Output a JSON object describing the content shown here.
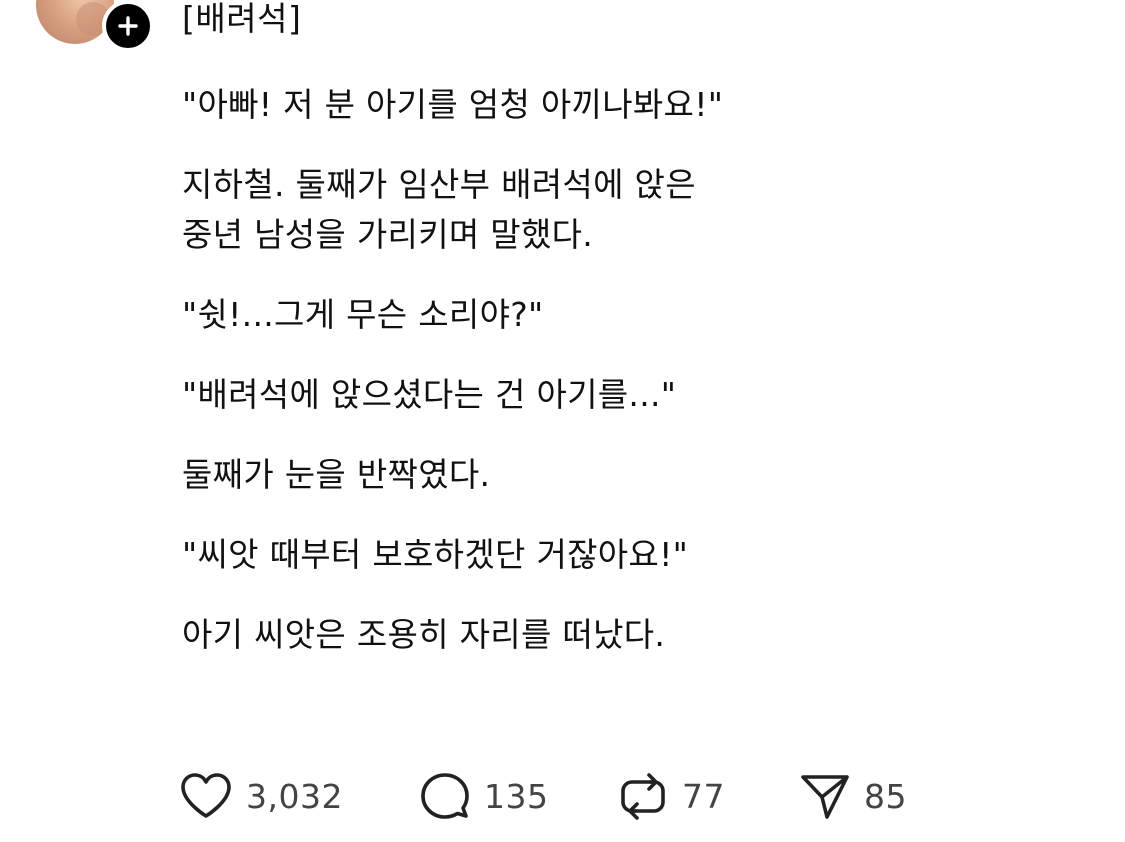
{
  "post": {
    "title": "[배려석]",
    "paragraphs": [
      "\"아빠! 저 분 아기를 엄청 아끼나봐요!\"",
      "지하철. 둘째가 임산부 배려석에 앉은\n중년 남성을 가리키며 말했다.",
      "\"쉿!...그게 무슨 소리야?\"",
      "\"배려석에 앉으셨다는 건 아기를...\"",
      "둘째가 눈을 반짝였다.",
      "\"씨앗 때부터 보호하겠단 거잖아요!\"",
      "아기 씨앗은 조용히 자리를 떠났다."
    ]
  },
  "actions": {
    "like": {
      "icon": "heart-icon",
      "count": "3,032"
    },
    "reply": {
      "icon": "speech-bubble-icon",
      "count": "135"
    },
    "repost": {
      "icon": "repost-icon",
      "count": "77"
    },
    "share": {
      "icon": "send-icon",
      "count": "85"
    }
  },
  "colors": {
    "text": "#111111",
    "count": "#444444",
    "badge": "#000000"
  }
}
